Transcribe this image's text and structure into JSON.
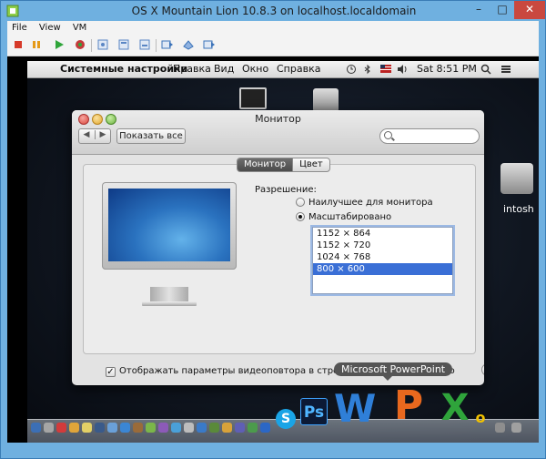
{
  "host": {
    "title": "OS X Mountain Lion 10.8.3 on localhost.localdomain",
    "controls": {
      "minimize": "–",
      "maximize": "□",
      "close": "✕"
    },
    "menu": [
      {
        "label": "File"
      },
      {
        "label": "View"
      },
      {
        "label": "VM"
      }
    ],
    "toolbar": [
      {
        "name": "power-off-icon",
        "color": "#d63a2a"
      },
      {
        "name": "suspend-icon",
        "color": "#e59a19"
      },
      {
        "name": "play-icon",
        "color": "#2fa53a"
      },
      {
        "name": "revert-icon",
        "color": "#c53a3a"
      },
      {
        "name": "snapshot-icon",
        "color": "#5a86c4"
      },
      {
        "name": "snapshot-manager-icon",
        "color": "#5a86c4"
      },
      {
        "name": "snapshot-list-icon",
        "color": "#5a86c4"
      },
      {
        "name": "fullscreen-icon",
        "color": "#3b73b9"
      },
      {
        "name": "unity-icon",
        "color": "#3b73b9"
      },
      {
        "name": "console-icon",
        "color": "#3b73b9"
      }
    ]
  },
  "mac_menubar": {
    "app_name": "Системные настройки",
    "items": [
      "Правка",
      "Вид",
      "Окно",
      "Справка"
    ],
    "time": "Sat 8:51 PM"
  },
  "desktop": {
    "drive_label": "intosh"
  },
  "prefs": {
    "title": "Монитор",
    "show_all": "Показать все",
    "search_placeholder": "",
    "tabs": [
      {
        "label": "Монитор",
        "active": true
      },
      {
        "label": "Цвет",
        "active": false
      }
    ],
    "resolution_label": "Разрешение:",
    "option_best": "Наилучшее для монитора",
    "option_scaled": "Масштабировано",
    "resolutions": [
      {
        "label": "1152 × 864",
        "selected": false
      },
      {
        "label": "1152 × 720",
        "selected": false
      },
      {
        "label": "1024 × 768",
        "selected": false
      },
      {
        "label": "800 × 600",
        "selected": true
      }
    ],
    "mirror_checked": true,
    "mirror_label": "Отображать параметры видеоповтора в строке меню, если доступно",
    "help": "?"
  },
  "dock": {
    "tooltip": "Microsoft PowerPoint",
    "apps": [
      {
        "name": "skype",
        "glyph": "S"
      },
      {
        "name": "photoshop",
        "glyph": "Ps"
      },
      {
        "name": "word",
        "glyph": "W"
      },
      {
        "name": "powerpoint",
        "glyph": "P"
      },
      {
        "name": "excel",
        "glyph": "X"
      },
      {
        "name": "outlook",
        "glyph": "o"
      }
    ]
  }
}
